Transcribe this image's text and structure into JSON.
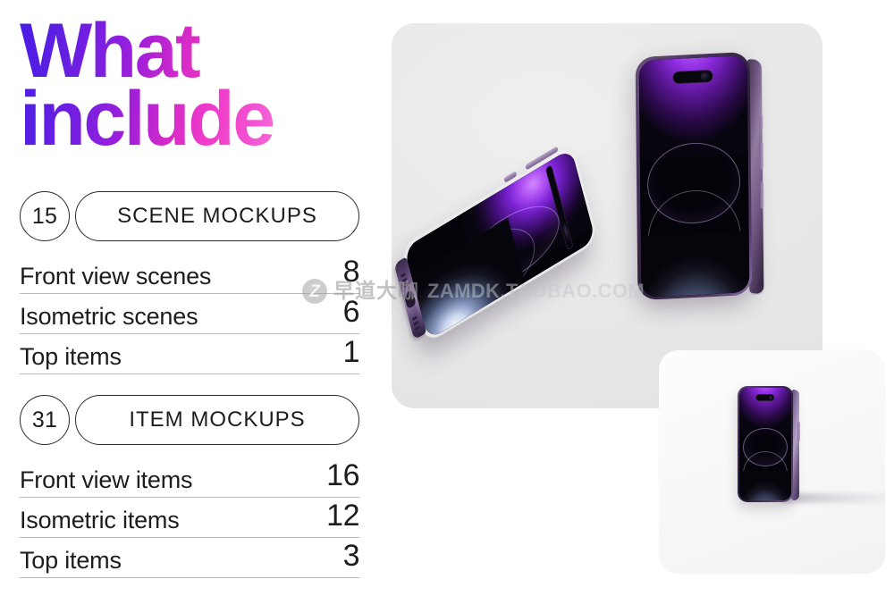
{
  "headline": {
    "line1": "What",
    "line2": "include",
    "gradient_start": "#4a1ae6",
    "gradient_mid": "#f03bc9",
    "gradient_end": "#f8bfec"
  },
  "sections": [
    {
      "count": "15",
      "title": "SCENE MOCKUPS",
      "rows": [
        {
          "label": "Front view scenes",
          "value": "8"
        },
        {
          "label": "Isometric scenes",
          "value": "6"
        },
        {
          "label": "Top items",
          "value": "1"
        }
      ]
    },
    {
      "count": "31",
      "title": "ITEM MOCKUPS",
      "rows": [
        {
          "label": "Front view items",
          "value": "16"
        },
        {
          "label": "Isometric items",
          "value": "12"
        },
        {
          "label": "Top items",
          "value": "3"
        }
      ]
    }
  ],
  "preview": {
    "scene_panel_bg": "#eaeaea",
    "item_card_bg": "#fbfbfb",
    "device_color_name": "deep-purple",
    "phones": [
      {
        "name": "phone-upright-large",
        "view": "front-angled"
      },
      {
        "name": "phone-flat-isometric",
        "view": "isometric"
      },
      {
        "name": "phone-upright-small",
        "view": "front"
      }
    ]
  },
  "watermark": {
    "logo": "Z",
    "brand_cn": "早道大咖",
    "url": "ZAMDK.TAOBAO.COM"
  }
}
